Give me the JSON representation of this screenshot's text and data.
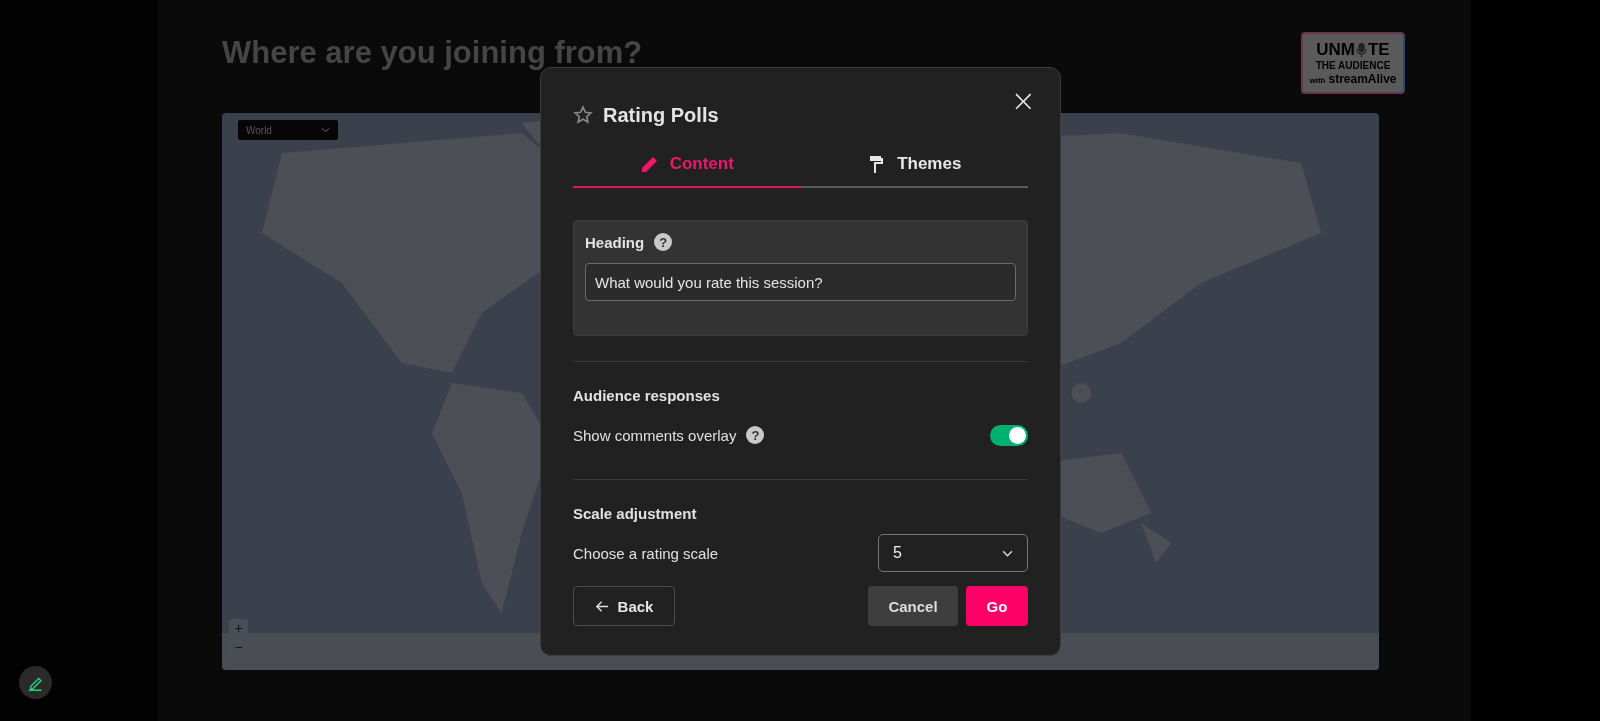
{
  "page": {
    "title": "Where are you joining from?"
  },
  "logo": {
    "word_start": "UNM",
    "word_end": "TE",
    "subtitle": "THE AUDIENCE",
    "with": "with",
    "brand": "streamAlive"
  },
  "map": {
    "kind": "picture",
    "region_select": {
      "value": "World"
    },
    "zoom_in": "+",
    "zoom_out": "−"
  },
  "dialog": {
    "title": "Rating Polls",
    "close": "×",
    "tabs": [
      {
        "label": "Content",
        "selected": true
      },
      {
        "label": "Themes",
        "selected": false
      }
    ],
    "heading_card": {
      "label": "Heading",
      "help": "?",
      "value": "What would you rate this session?"
    },
    "sections": [
      {
        "title": "Audience responses",
        "row": {
          "kind": "toggle",
          "label": "Show comments overlay",
          "help": "?",
          "on": true
        }
      },
      {
        "title": "Scale adjustment",
        "row": {
          "kind": "select",
          "label": "Choose a rating scale",
          "value": "5"
        }
      }
    ],
    "back": "Back",
    "cancel": "Cancel",
    "go": "Go"
  }
}
